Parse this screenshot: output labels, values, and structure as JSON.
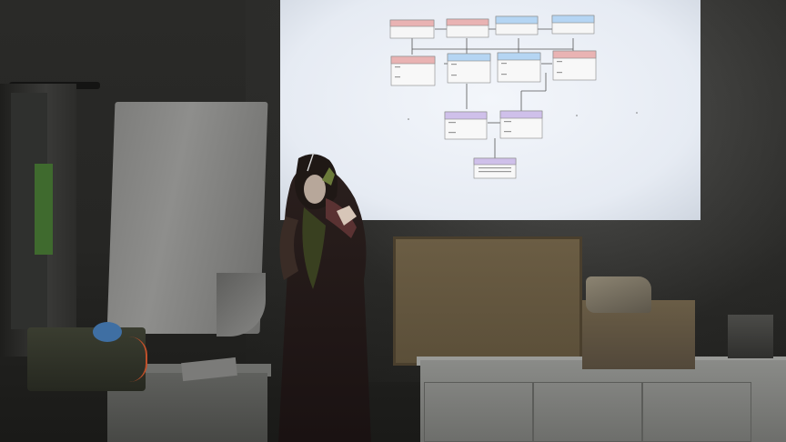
{
  "scene": {
    "description_label": "",
    "accent_colors": {
      "screen": "#eef2f8",
      "box_red": "#e8b4b4",
      "box_blue": "#b7d6f2",
      "box_purple": "#cfc0ea",
      "wall": "#2a2a28",
      "cabinet": "#7a7b78",
      "corkboard": "#5f523c"
    }
  },
  "diagram": {
    "top_row": [
      {
        "color": "red"
      },
      {
        "color": "red"
      },
      {
        "color": "blue"
      },
      {
        "color": "blue"
      }
    ],
    "mid_row": [
      {
        "color": "red"
      },
      {
        "color": "blue"
      },
      {
        "color": "blue"
      },
      {
        "color": "red"
      }
    ],
    "bottom_row": [
      {
        "color": "purple"
      },
      {
        "color": "purple"
      }
    ],
    "final": {
      "color": "purple"
    }
  }
}
